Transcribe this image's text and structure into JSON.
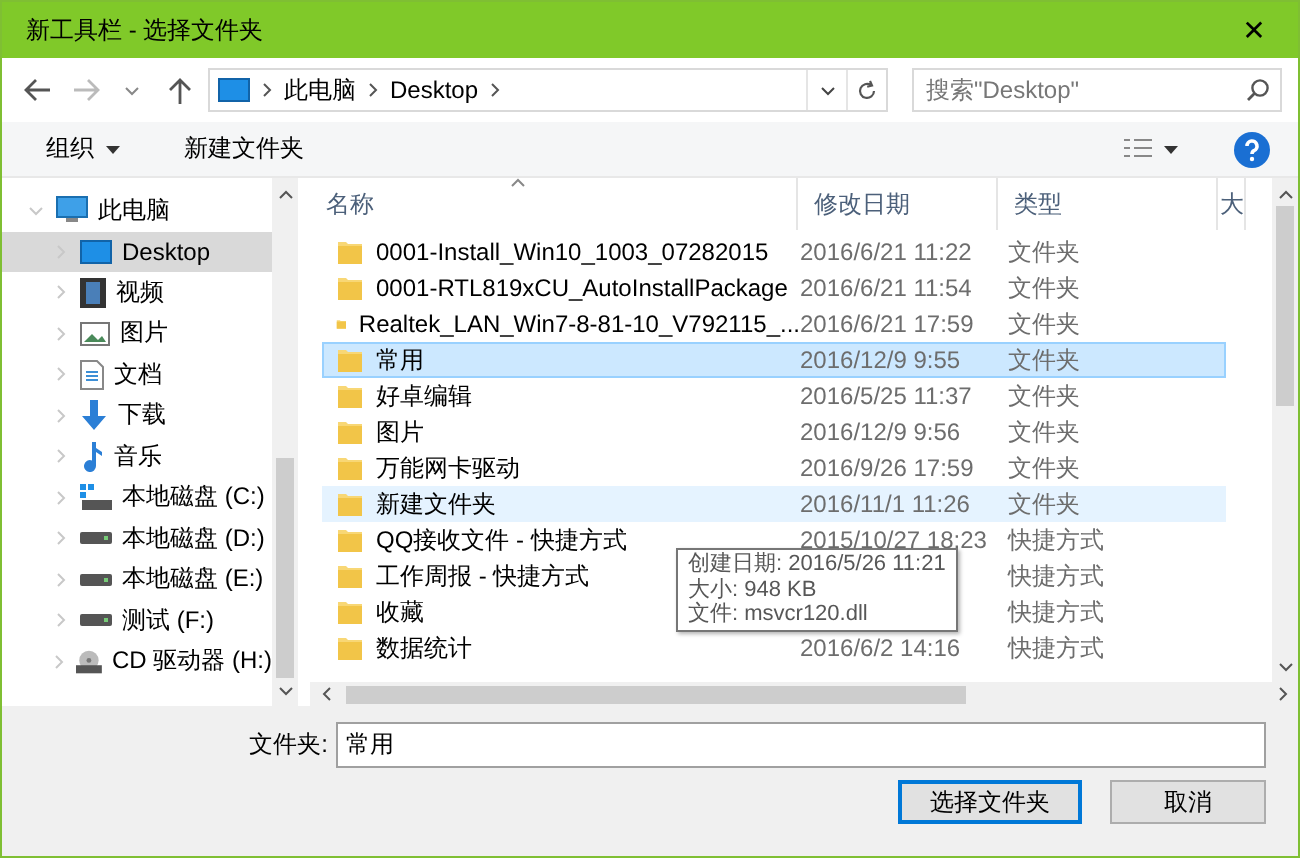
{
  "window": {
    "title": "新工具栏 - 选择文件夹",
    "close": "✕"
  },
  "address": {
    "path": [
      "此电脑",
      "Desktop"
    ],
    "search_placeholder": "搜索\"Desktop\""
  },
  "toolbar": {
    "organize": "组织",
    "new_folder": "新建文件夹"
  },
  "sidebar": {
    "items": [
      {
        "label": "此电脑",
        "kind": "computer",
        "expanded": true,
        "selected": false,
        "children": [
          {
            "label": "Desktop",
            "kind": "desktop",
            "expanded": false,
            "selected": true
          },
          {
            "label": "视频",
            "kind": "video",
            "expanded": false,
            "selected": false
          },
          {
            "label": "图片",
            "kind": "pictures",
            "expanded": false,
            "selected": false
          },
          {
            "label": "文档",
            "kind": "documents",
            "expanded": false,
            "selected": false
          },
          {
            "label": "下载",
            "kind": "downloads",
            "expanded": false,
            "selected": false
          },
          {
            "label": "音乐",
            "kind": "music",
            "expanded": false,
            "selected": false
          },
          {
            "label": "本地磁盘 (C:)",
            "kind": "system-drive",
            "expanded": false,
            "selected": false
          },
          {
            "label": "本地磁盘 (D:)",
            "kind": "drive",
            "expanded": false,
            "selected": false
          },
          {
            "label": "本地磁盘 (E:)",
            "kind": "drive",
            "expanded": false,
            "selected": false
          },
          {
            "label": "测试 (F:)",
            "kind": "drive",
            "expanded": false,
            "selected": false
          },
          {
            "label": "CD 驱动器 (H:)",
            "kind": "cd",
            "expanded": false,
            "selected": false
          }
        ]
      }
    ]
  },
  "table": {
    "columns": [
      "名称",
      "修改日期",
      "类型",
      "大"
    ],
    "rows": [
      {
        "name": "0001-Install_Win10_1003_07282015",
        "date": "2016/6/21 11:22",
        "type": "文件夹",
        "selected": false,
        "hovered": false
      },
      {
        "name": "0001-RTL819xCU_AutoInstallPackage",
        "date": "2016/6/21 11:54",
        "type": "文件夹",
        "selected": false,
        "hovered": false
      },
      {
        "name": "Realtek_LAN_Win7-8-81-10_V792115_...",
        "date": "2016/6/21 17:59",
        "type": "文件夹",
        "selected": false,
        "hovered": false
      },
      {
        "name": "常用",
        "date": "2016/12/9 9:55",
        "type": "文件夹",
        "selected": true,
        "hovered": false
      },
      {
        "name": "好卓编辑",
        "date": "2016/5/25 11:37",
        "type": "文件夹",
        "selected": false,
        "hovered": false
      },
      {
        "name": "图片",
        "date": "2016/12/9 9:56",
        "type": "文件夹",
        "selected": false,
        "hovered": false
      },
      {
        "name": "万能网卡驱动",
        "date": "2016/9/26 17:59",
        "type": "文件夹",
        "selected": false,
        "hovered": false
      },
      {
        "name": "新建文件夹",
        "date": "2016/11/1 11:26",
        "type": "文件夹",
        "selected": false,
        "hovered": true
      },
      {
        "name": "QQ接收文件 - 快捷方式",
        "date": "2015/10/27 18:23",
        "type": "快捷方式",
        "selected": false,
        "hovered": false
      },
      {
        "name": "工作周报 - 快捷方式",
        "type": "快捷方式",
        "selected": false,
        "hovered": false
      },
      {
        "name": "收藏",
        "type": "快捷方式",
        "selected": false,
        "hovered": false
      },
      {
        "name": "数据统计",
        "date": "2016/6/2 14:16",
        "type": "快捷方式",
        "selected": false,
        "hovered": false
      }
    ]
  },
  "tooltip": {
    "lines": [
      "创建日期: 2016/5/26 11:21",
      "大小: 948 KB",
      "文件: msvcr120.dll"
    ]
  },
  "footer": {
    "folder_label": "文件夹:",
    "folder_value": "常用",
    "buttons": [
      "选择文件夹",
      "取消"
    ]
  }
}
